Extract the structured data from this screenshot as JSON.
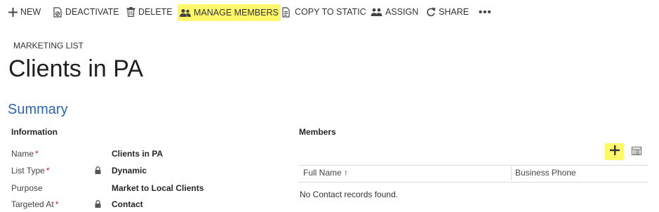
{
  "toolbar": {
    "new_label": "NEW",
    "deactivate_label": "DEACTIVATE",
    "delete_label": "DELETE",
    "manage_members_label": "MANAGE MEMBERS",
    "copy_to_static_label": "COPY TO STATIC",
    "assign_label": "ASSIGN",
    "share_label": "SHARE",
    "more_label": "•••",
    "highlight_color": "#fff86a"
  },
  "header": {
    "entity_type": "MARKETING LIST",
    "title": "Clients in PA"
  },
  "summary": {
    "heading": "Summary",
    "information": {
      "heading": "Information",
      "fields": [
        {
          "label": "Name",
          "required": "*",
          "locked": false,
          "value": "Clients in PA"
        },
        {
          "label": "List Type",
          "required": "*",
          "locked": true,
          "value": "Dynamic"
        },
        {
          "label": "Purpose",
          "required": "",
          "locked": false,
          "value": "Market to Local Clients"
        },
        {
          "label": "Targeted At",
          "required": "*",
          "locked": true,
          "value": "Contact"
        }
      ]
    },
    "members": {
      "heading": "Members",
      "columns": [
        "Full Name ↑",
        "Business Phone"
      ],
      "empty_message": "No Contact records found."
    }
  },
  "colors": {
    "accent_blue": "#2b66b0",
    "required_red": "#c0202a",
    "highlight_yellow": "#fff86a"
  }
}
